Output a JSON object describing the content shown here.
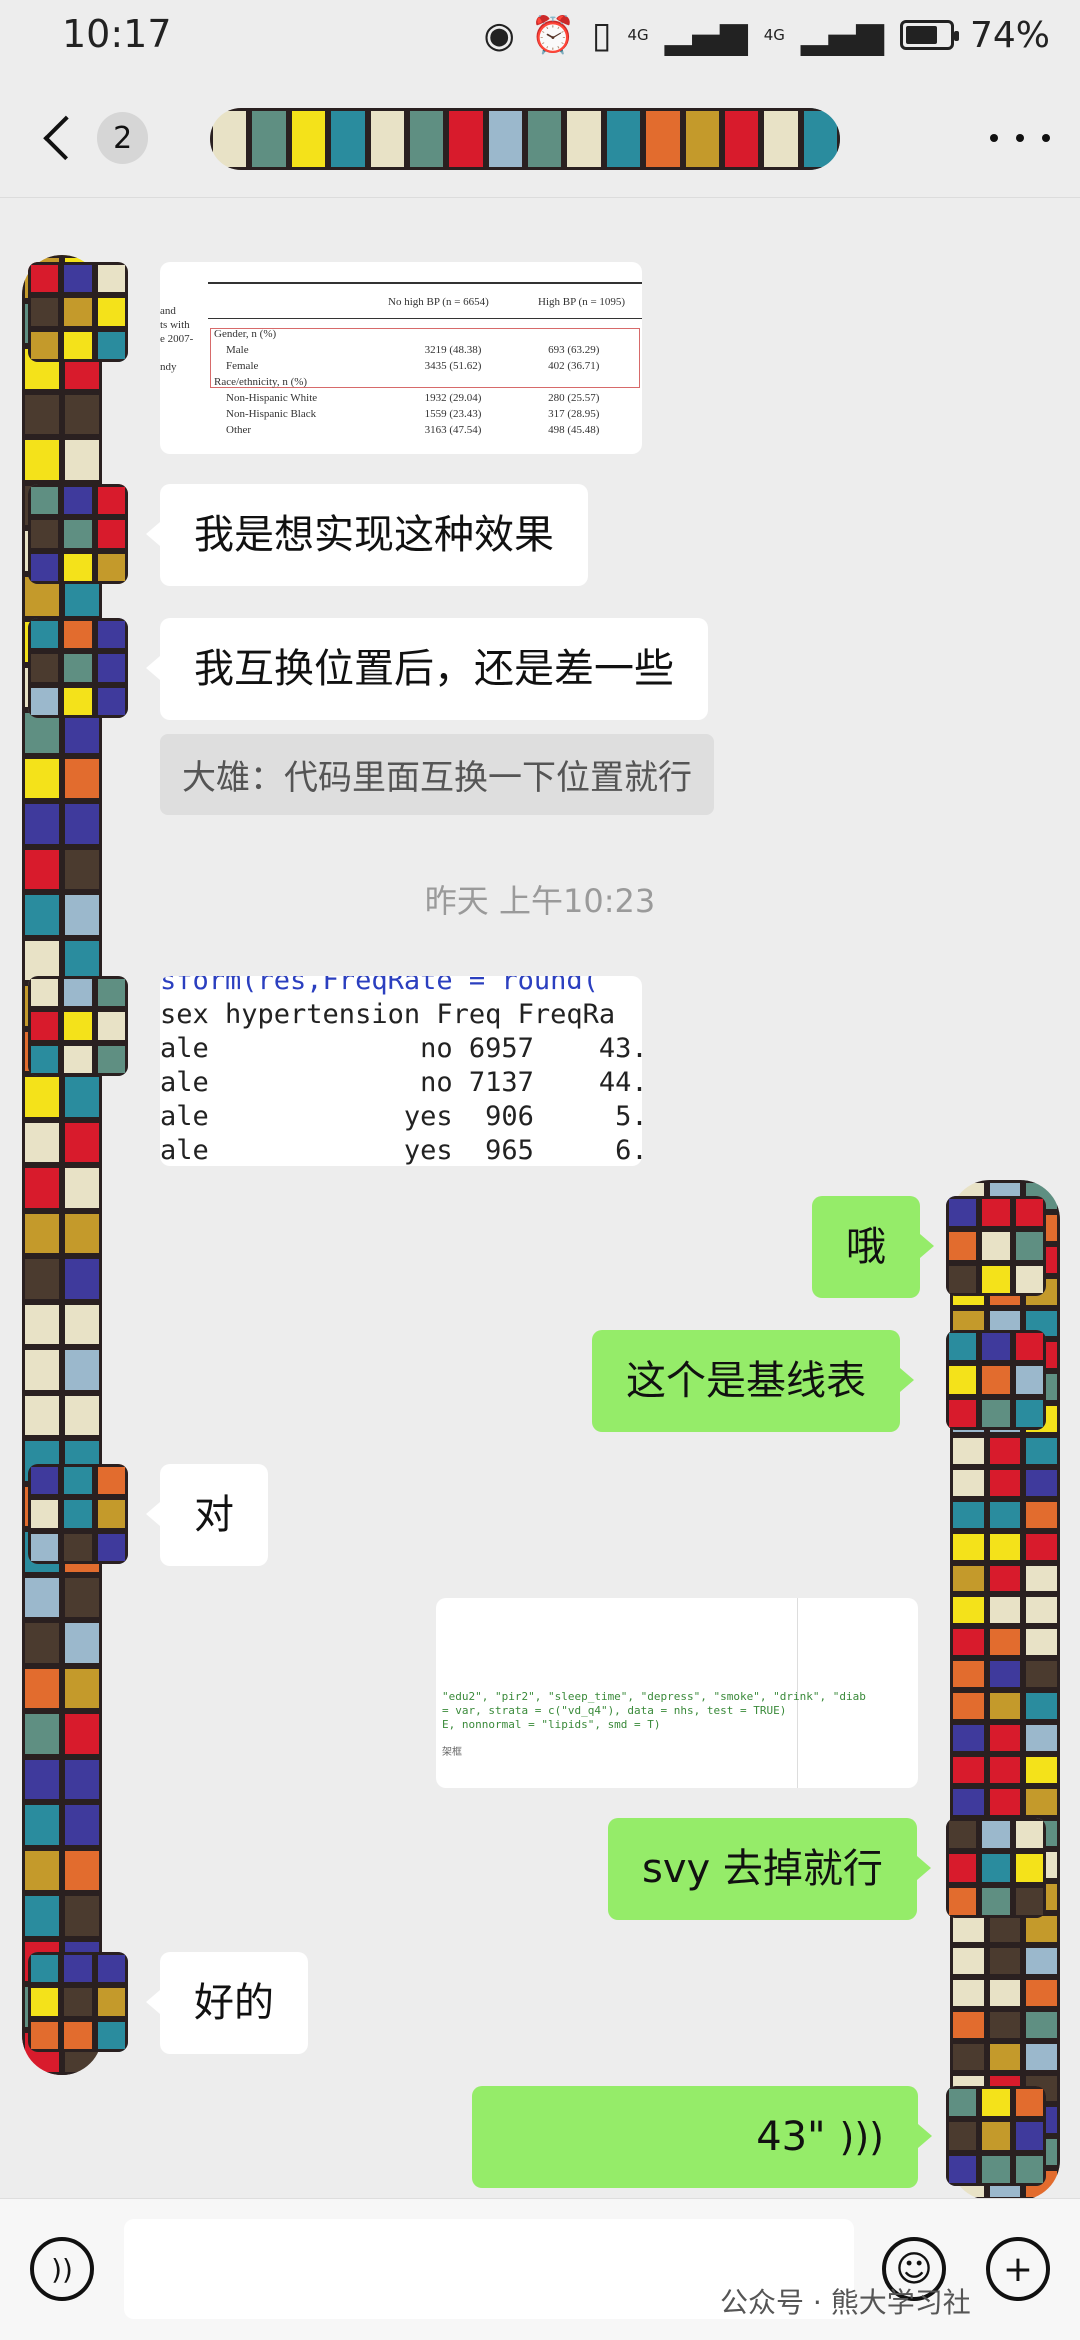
{
  "status_bar": {
    "time": "10:17",
    "net1": "4G",
    "net2": "4G",
    "battery": "74%",
    "battery_level": 0.74
  },
  "nav": {
    "unread_count": "2"
  },
  "messages": {
    "img1_table": {
      "left_text": [
        "and",
        "ts with",
        "e 2007-",
        "",
        "ndy"
      ],
      "col_headers": [
        "No high BP (n = 6654)",
        "High BP (n = 1095)"
      ],
      "rows": [
        [
          "Gender, n (%)",
          "",
          ""
        ],
        [
          "Male",
          "3219 (48.38)",
          "693 (63.29)"
        ],
        [
          "Female",
          "3435 (51.62)",
          "402 (36.71)"
        ],
        [
          "Race/ethnicity, n (%)",
          "",
          ""
        ],
        [
          "Non-Hispanic White",
          "1932 (29.04)",
          "280 (25.57)"
        ],
        [
          "Non-Hispanic Black",
          "1559 (23.43)",
          "317 (28.95)"
        ],
        [
          "Other",
          "3163 (47.54)",
          "498 (45.48)"
        ]
      ]
    },
    "m1": "我是想实现这种效果",
    "m2": "我互换位置后，还是差一些",
    "quote": "大雄：代码里面互换一下位置就行",
    "timestamp": "昨天 上午10:23",
    "img2_code": [
      "sform(res,FreqRate = round(",
      "sex hypertension Freq FreqRa",
      "ale             no 6957    43.",
      "ale             no 7137    44.",
      "ale            yes  906     5.",
      "ale            yes  965     6."
    ],
    "m3": "哦",
    "m4": "这个是基线表",
    "m5": "对",
    "img3_code": [
      "\"edu2\", \"pir2\", \"sleep_time\", \"depress\", \"smoke\", \"drink\", \"diab",
      "= var, strata = c(\"vd_q4\"), data = nhs, test = TRUE)",
      "E, nonnormal = \"lipids\", smd = T)",
      "",
      "架框"
    ],
    "m6": "svy 去掉就行",
    "m7": "好的",
    "voice_duration": "43\""
  },
  "input_bar": {
    "watermark": "公众号 · 熊大学习社"
  },
  "colors": {
    "background": "#ededed",
    "bubble_self": "#95ec69",
    "bubble_other": "#ffffff",
    "mosaic": [
      "#d81b2c",
      "#f4e21a",
      "#2a8c9e",
      "#3f3a9c",
      "#e8e2c6",
      "#5f8f82",
      "#c49a2b",
      "#e26c2e",
      "#9bb8cc",
      "#4b3b2f"
    ]
  },
  "icons": [
    "back-chevron-icon",
    "more-icon",
    "voice-toggle-icon",
    "emoji-icon",
    "add-icon",
    "wave-icon"
  ]
}
